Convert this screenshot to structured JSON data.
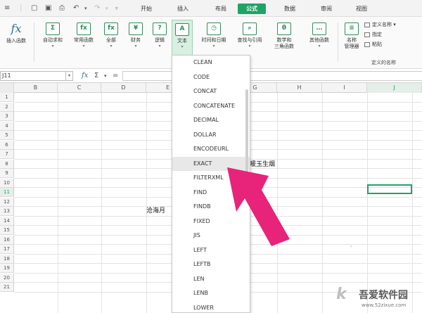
{
  "menubar": {
    "menu_icon": "hamburger-icon",
    "tabs": [
      "开始",
      "插入",
      "布局",
      "公式",
      "数据",
      "审阅",
      "视图"
    ],
    "active_tab": "公式",
    "accent": "#21a366"
  },
  "ribbon": {
    "buttons": [
      {
        "label": "插入函数",
        "icon": "fx"
      },
      {
        "label": "自动求和",
        "icon": "Σ"
      },
      {
        "label": "常用函数",
        "icon": "fx"
      },
      {
        "label": "全部",
        "icon": "fx"
      },
      {
        "label": "财务",
        "icon": "¥"
      },
      {
        "label": "逻辑",
        "icon": "?"
      },
      {
        "label": "文本",
        "icon": "A"
      },
      {
        "label": "时间和日期",
        "icon": "◷"
      },
      {
        "label": "查找与引用",
        "icon": "⌕"
      },
      {
        "label": "数学和",
        "label2": "三角函数",
        "icon": "θ"
      },
      {
        "label": "其他函数",
        "icon": "…"
      },
      {
        "label": "名称",
        "label2": "管理器",
        "icon": "≡"
      }
    ],
    "names": {
      "define_name": "定义名称",
      "specify": "指定",
      "paste": "粘贴",
      "group_label": "定义的名称"
    }
  },
  "formula_bar": {
    "name_box": "J11",
    "fx": "fx",
    "sigma": "Σ",
    "equals": "="
  },
  "grid": {
    "columns": [
      "B",
      "C",
      "D",
      "E",
      "F",
      "G",
      "H",
      "I",
      "J"
    ],
    "rows": [
      "1",
      "2",
      "3",
      "4",
      "5",
      "6",
      "7",
      "8",
      "9",
      "10",
      "11",
      "12",
      "13",
      "14",
      "15",
      "16",
      "17",
      "18",
      "19",
      "20",
      "21"
    ],
    "cell_g8": "日暖玉生烟",
    "cell_e13": "沧海月"
  },
  "dropdown": {
    "items": [
      "CLEAN",
      "CODE",
      "CONCAT",
      "CONCATENATE",
      "DECIMAL",
      "DOLLAR",
      "ENCODEURL",
      "EXACT",
      "FILTERXML",
      "FIND",
      "FINDB",
      "FIXED",
      "JIS",
      "LEFT",
      "LEFTB",
      "LEN",
      "LENB",
      "LOWER"
    ],
    "highlighted": "EXACT"
  },
  "annotation": {
    "color": "#e8237a"
  },
  "watermark": {
    "logo": "k",
    "title": "吾爱软件园",
    "url": "www.52zixue.com"
  }
}
